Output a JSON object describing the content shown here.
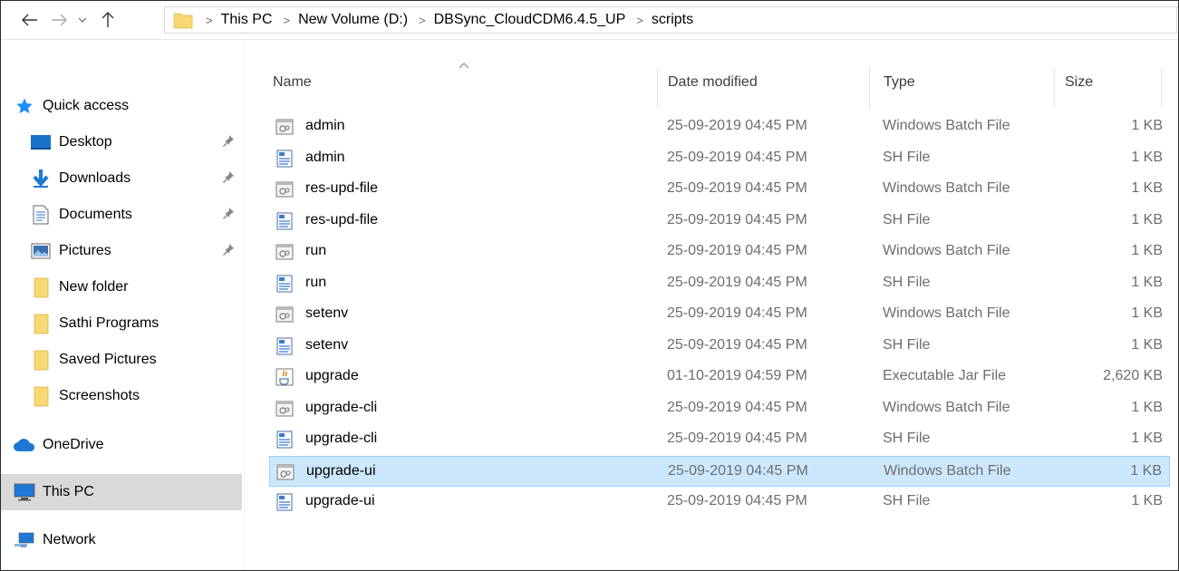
{
  "address_bar": {
    "breadcrumbs": [
      "This PC",
      "New Volume (D:)",
      "DBSync_CloudCDM6.4.5_UP",
      "scripts"
    ]
  },
  "nav_pane": {
    "quick_access": "Quick access",
    "items": [
      {
        "label": "Desktop",
        "icon": "desktop-icon",
        "pinned": true
      },
      {
        "label": "Downloads",
        "icon": "downloads-icon",
        "pinned": true
      },
      {
        "label": "Documents",
        "icon": "documents-icon",
        "pinned": true
      },
      {
        "label": "Pictures",
        "icon": "pictures-icon",
        "pinned": true
      },
      {
        "label": "New folder",
        "icon": "folder-icon",
        "pinned": false
      },
      {
        "label": "Sathi Programs",
        "icon": "folder-icon",
        "pinned": false
      },
      {
        "label": "Saved Pictures",
        "icon": "folder-icon",
        "pinned": false
      },
      {
        "label": "Screenshots",
        "icon": "folder-icon",
        "pinned": false
      }
    ],
    "onedrive": "OneDrive",
    "this_pc": "This PC",
    "network": "Network"
  },
  "file_list": {
    "columns": {
      "name": "Name",
      "date": "Date modified",
      "type": "Type",
      "size": "Size"
    },
    "selected_index": 11,
    "rows": [
      {
        "name": "admin",
        "date": "25-09-2019 04:45 PM",
        "type": "Windows Batch File",
        "size": "1 KB",
        "icon": "batch-file-icon"
      },
      {
        "name": "admin",
        "date": "25-09-2019 04:45 PM",
        "type": "SH File",
        "size": "1 KB",
        "icon": "sh-file-icon"
      },
      {
        "name": "res-upd-file",
        "date": "25-09-2019 04:45 PM",
        "type": "Windows Batch File",
        "size": "1 KB",
        "icon": "batch-file-icon"
      },
      {
        "name": "res-upd-file",
        "date": "25-09-2019 04:45 PM",
        "type": "SH File",
        "size": "1 KB",
        "icon": "sh-file-icon"
      },
      {
        "name": "run",
        "date": "25-09-2019 04:45 PM",
        "type": "Windows Batch File",
        "size": "1 KB",
        "icon": "batch-file-icon"
      },
      {
        "name": "run",
        "date": "25-09-2019 04:45 PM",
        "type": "SH File",
        "size": "1 KB",
        "icon": "sh-file-icon"
      },
      {
        "name": "setenv",
        "date": "25-09-2019 04:45 PM",
        "type": "Windows Batch File",
        "size": "1 KB",
        "icon": "batch-file-icon"
      },
      {
        "name": "setenv",
        "date": "25-09-2019 04:45 PM",
        "type": "SH File",
        "size": "1 KB",
        "icon": "sh-file-icon"
      },
      {
        "name": "upgrade",
        "date": "01-10-2019 04:59 PM",
        "type": "Executable Jar File",
        "size": "2,620 KB",
        "icon": "jar-file-icon"
      },
      {
        "name": "upgrade-cli",
        "date": "25-09-2019 04:45 PM",
        "type": "Windows Batch File",
        "size": "1 KB",
        "icon": "batch-file-icon"
      },
      {
        "name": "upgrade-cli",
        "date": "25-09-2019 04:45 PM",
        "type": "SH File",
        "size": "1 KB",
        "icon": "sh-file-icon"
      },
      {
        "name": "upgrade-ui",
        "date": "25-09-2019 04:45 PM",
        "type": "Windows Batch File",
        "size": "1 KB",
        "icon": "batch-file-icon"
      },
      {
        "name": "upgrade-ui",
        "date": "25-09-2019 04:45 PM",
        "type": "SH File",
        "size": "1 KB",
        "icon": "sh-file-icon"
      }
    ]
  },
  "colors": {
    "selection_bg": "#cce8ff",
    "selection_border": "#99d1ff",
    "nav_selected_bg": "#d9d9d9",
    "folder_yellow": "#f8d775",
    "quick_access_blue": "#1e90ff"
  }
}
